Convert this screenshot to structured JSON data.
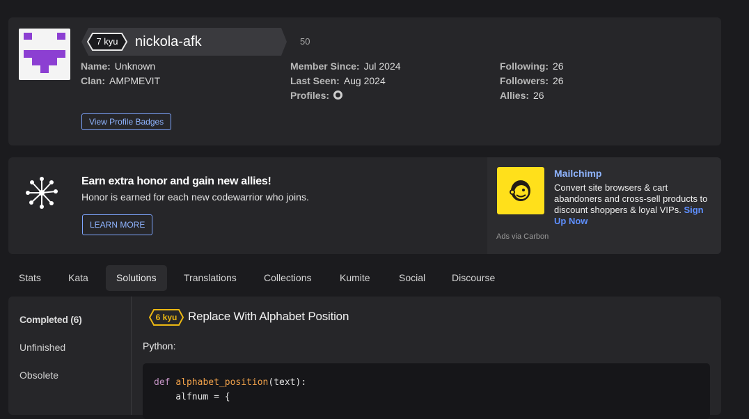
{
  "profile": {
    "rank": "7 kyu",
    "username": "nickola-afk",
    "honor": "50",
    "name_label": "Name:",
    "name_value": "Unknown",
    "clan_label": "Clan:",
    "clan_value": "AMPMEVIT",
    "member_since_label": "Member Since:",
    "member_since_value": "Jul 2024",
    "last_seen_label": "Last Seen:",
    "last_seen_value": "Aug 2024",
    "profiles_label": "Profiles:",
    "following_label": "Following:",
    "following_value": "26",
    "followers_label": "Followers:",
    "followers_value": "26",
    "allies_label": "Allies:",
    "allies_value": "26",
    "badges_button": "View Profile Badges",
    "avatar_color": "#8c3fd2"
  },
  "promo": {
    "title": "Earn extra honor and gain new allies!",
    "text": "Honor is earned for each new codewarrior who joins.",
    "button": "LEARN MORE"
  },
  "ad": {
    "brand": "Mailchimp",
    "text": "Convert site browsers & cart abandoners and cross-sell products to discount shoppers & loyal VIPs.",
    "cta": "Sign Up Now",
    "via": "Ads via Carbon",
    "logo_color": "#ffe01b"
  },
  "tabs": [
    "Stats",
    "Kata",
    "Solutions",
    "Translations",
    "Collections",
    "Kumite",
    "Social",
    "Discourse"
  ],
  "active_tab": "Solutions",
  "side_nav": [
    "Completed (6)",
    "Unfinished",
    "Obsolete"
  ],
  "solution": {
    "rank": "6 kyu",
    "title": "Replace With Alphabet Position",
    "language": "Python:",
    "code_keyword": "def",
    "code_function": "alphabet_position",
    "code_params": "(text):",
    "code_line2": "    alfnum = {"
  },
  "colors": {
    "accent_link": "#7ea6ff",
    "kyu6": "#ecb813",
    "background": "#1b1b1e",
    "card": "#262629"
  }
}
